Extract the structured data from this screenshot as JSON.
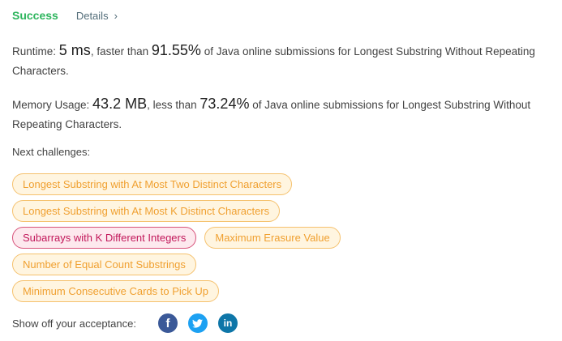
{
  "status": "Success",
  "details_label": "Details",
  "runtime": {
    "label": "Runtime:",
    "value": "5 ms",
    "comparison": ", faster than",
    "percent": "91.55%",
    "suffix": "of Java online submissions for Longest Substring Without Repeating Characters."
  },
  "memory": {
    "label": "Memory Usage:",
    "value": "43.2 MB",
    "comparison": ", less than",
    "percent": "73.24%",
    "suffix": "of Java online submissions for Longest Substring Without Repeating Characters."
  },
  "next_challenges": {
    "label": "Next challenges:",
    "items": [
      {
        "title": "Longest Substring with At Most Two Distinct Characters",
        "difficulty": "medium"
      },
      {
        "title": "Longest Substring with At Most K Distinct Characters",
        "difficulty": "medium"
      },
      {
        "title": "Subarrays with K Different Integers",
        "difficulty": "hard"
      },
      {
        "title": "Maximum Erasure Value",
        "difficulty": "medium"
      },
      {
        "title": "Number of Equal Count Substrings",
        "difficulty": "medium"
      },
      {
        "title": "Minimum Consecutive Cards to Pick Up",
        "difficulty": "medium"
      }
    ]
  },
  "share": {
    "label": "Show off your acceptance:",
    "icons": [
      "facebook-icon",
      "twitter-icon",
      "linkedin-icon"
    ]
  },
  "colors": {
    "success": "#2db55d",
    "medium_text": "#f0a030",
    "medium_bg": "#fff5e0",
    "hard_text": "#c2185b",
    "hard_bg": "#fde9ee",
    "facebook": "#3b5998",
    "twitter": "#1da1f2",
    "linkedin": "#0e76a8"
  }
}
